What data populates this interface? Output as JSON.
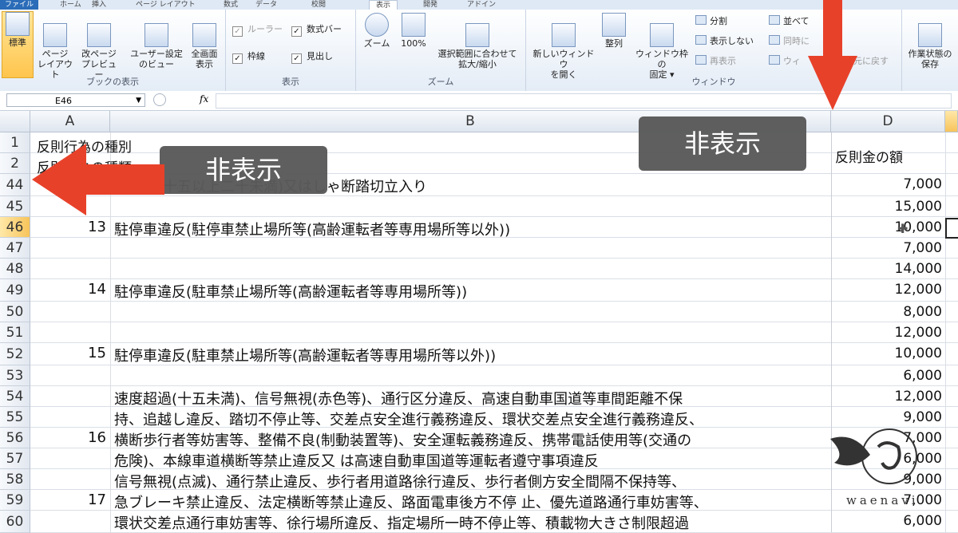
{
  "ribbon": {
    "tabs": [
      "ファイル",
      "ホーム",
      "挿入",
      "ページ レイアウト",
      "数式",
      "データ",
      "校閲",
      "表示",
      "開発",
      "アドイン"
    ],
    "groups": {
      "workbook_views": {
        "label": "ブックの表示",
        "buttons": [
          "標準",
          "ページ\nレイアウト",
          "改ページ\nプレビュー",
          "ユーザー設定\nのビュー",
          "全画面\n表示"
        ]
      },
      "show": {
        "label": "表示",
        "checks": [
          {
            "label": "ルーラー",
            "checked": true,
            "disabled": true
          },
          {
            "label": "数式バー",
            "checked": true,
            "disabled": false
          },
          {
            "label": "枠線",
            "checked": true,
            "disabled": false
          },
          {
            "label": "見出し",
            "checked": true,
            "disabled": false
          }
        ]
      },
      "zoom": {
        "label": "ズーム",
        "buttons": [
          "ズーム",
          "100%",
          "選択範囲に合わせて\n拡大/縮小"
        ]
      },
      "window": {
        "label": "ウィンドウ",
        "buttons": [
          "新しいウィンドウ\nを開く",
          "整列",
          "ウィンドウ枠の\n固定 ▾"
        ],
        "small": [
          "分割",
          "表示しない",
          "再表示",
          "並べて",
          "同時に",
          "ウィ",
          "元に戻す"
        ],
        "save_workspace": "作業状態の\n保存"
      }
    }
  },
  "formula_bar": {
    "name_box": "E46",
    "fx": "fx",
    "value": ""
  },
  "columns": {
    "A": "A",
    "B": "B",
    "D": "D"
  },
  "rows": [
    {
      "num": "1",
      "a": "",
      "b": "",
      "d": ""
    },
    {
      "num": "2",
      "a": "",
      "b": "",
      "d": ""
    },
    {
      "num": "44",
      "a": "",
      "b": "度超過(十五以上二十未満)又はしゃ断踏切立入り",
      "d": "7,000"
    },
    {
      "num": "45",
      "a": "",
      "b": "",
      "d": "15,000"
    },
    {
      "num": "46",
      "a": "13",
      "b": "駐停車違反(駐停車禁止場所等(高齢運転者等専用場所等以外))",
      "d": "10,000"
    },
    {
      "num": "47",
      "a": "",
      "b": "",
      "d": "7,000"
    },
    {
      "num": "48",
      "a": "",
      "b": "",
      "d": "14,000"
    },
    {
      "num": "49",
      "a": "14",
      "b": "駐停車違反(駐車禁止場所等(高齢運転者等専用場所等))",
      "d": "12,000"
    },
    {
      "num": "50",
      "a": "",
      "b": "",
      "d": "8,000"
    },
    {
      "num": "51",
      "a": "",
      "b": "",
      "d": "12,000"
    },
    {
      "num": "52",
      "a": "15",
      "b": "駐停車違反(駐車禁止場所等(高齢運転者等専用場所等以外))",
      "d": "10,000"
    },
    {
      "num": "53",
      "a": "",
      "b": "",
      "d": "6,000"
    },
    {
      "num": "54",
      "a": "",
      "b": "速度超過(十五未満)、信号無視(赤色等)、通行区分違反、高速自動車国道等車間距離不保",
      "d": "12,000"
    },
    {
      "num": "55",
      "a": "",
      "b": "持、追越し違反、踏切不停止等、交差点安全進行義務違反、環状交差点安全進行義務違反、",
      "d": "9,000"
    },
    {
      "num": "56",
      "a": "16",
      "b": "横断歩行者等妨害等、整備不良(制動装置等)、安全運転義務違反、携帯電話使用等(交通の",
      "d": "7,000"
    },
    {
      "num": "57",
      "a": "",
      "b": "危険)、本線車道横断等禁止違反又 は高速自動車国道等運転者遵守事項違反",
      "d": "6,000"
    },
    {
      "num": "58",
      "a": "",
      "b": "信号無視(点滅)、通行禁止違反、歩行者用道路徐行違反、歩行者側方安全間隔不保持等、",
      "d": "9,000"
    },
    {
      "num": "59",
      "a": "17",
      "b": "急ブレーキ禁止違反、法定横断等禁止違反、路面電車後方不停 止、優先道路通行車妨害等、",
      "d": "7,000"
    },
    {
      "num": "60",
      "a": "",
      "b": "環状交差点通行車妨害等、徐行場所違反、指定場所一時不停止等、積載物大きさ制限超過",
      "d": "6,000"
    }
  ],
  "header_labels": {
    "r1": "反則行為の種別",
    "r2": "反則行為の種類",
    "d2": "反則金の額"
  },
  "overlays": {
    "banner_left": "非表示",
    "banner_right": "非表示"
  },
  "watermark": {
    "text": "waenavi"
  },
  "colors": {
    "arrow": "#e8412a",
    "banner": "#5a5a5a",
    "selected": "#f7c45a"
  }
}
